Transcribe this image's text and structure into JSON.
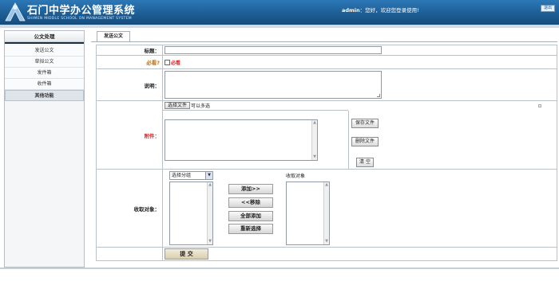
{
  "header": {
    "title": "石门中学办公管理系统",
    "subtitle": "SHIMEN MIDDLE SCHOOL ON MANAGEMENT SYSTEM",
    "user": "admin",
    "welcome": "：您好，欢迎您登录使用!",
    "logout_label": "退出"
  },
  "sidebar": {
    "section_title": "公文处理",
    "items": [
      {
        "label": "发送公文"
      },
      {
        "label": "草拟公文"
      },
      {
        "label": "发件箱"
      },
      {
        "label": "收件箱"
      }
    ],
    "other_section": "其他功能"
  },
  "tab": {
    "label": "发送公文"
  },
  "form": {
    "title_label": "标题：",
    "title_value": "",
    "must_reply_label": "必看?",
    "must_reply_text": "必看",
    "desc_label": "说明：",
    "desc_value": "",
    "attachment_label": "附件：",
    "choose_file_label": "选择文件",
    "multi_select_note": "可以多选",
    "save_file_label": "保存文件",
    "delete_file_label": "删除文件",
    "clear_label": "清 空",
    "recipients_label": "收取对象：",
    "group_select_value": "选择分组",
    "add_label": "添加>>",
    "remove_label": "<<移除",
    "add_all_label": "全部添加",
    "reselect_label": "重新选择",
    "recipients_title": "收取对象",
    "submit_label": "提 交"
  },
  "colors": {
    "header_blue": "#1c5c93",
    "required_red": "#dd2222",
    "border_gray": "#b9c2cb"
  }
}
